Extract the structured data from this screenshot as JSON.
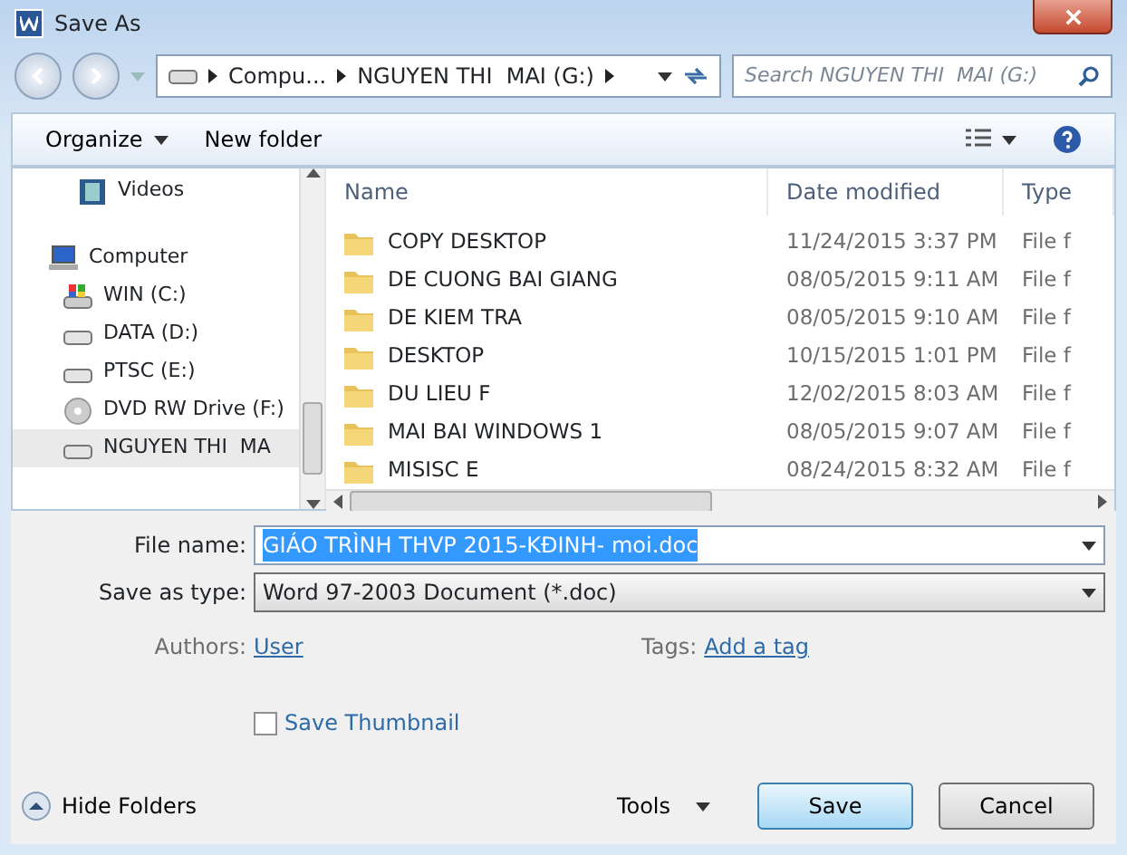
{
  "window": {
    "title": "Save As"
  },
  "address_bar": {
    "crumbs": [
      "Compu...",
      "NGUYEN THI  MAI (G:)"
    ]
  },
  "search": {
    "placeholder": "Search NGUYEN THI  MAI (G:)"
  },
  "toolbar": {
    "organize": "Organize",
    "new_folder": "New folder"
  },
  "sidebar": {
    "items": [
      {
        "label": "Videos",
        "kind": "video",
        "selected": false
      },
      {
        "label": "Computer",
        "kind": "computer",
        "selected": false
      },
      {
        "label": "WIN (C:)",
        "kind": "system-drive",
        "selected": false
      },
      {
        "label": "DATA (D:)",
        "kind": "drive",
        "selected": false
      },
      {
        "label": "PTSC (E:)",
        "kind": "drive",
        "selected": false
      },
      {
        "label": "DVD RW Drive (F:)",
        "kind": "dvd",
        "selected": false
      },
      {
        "label": "NGUYEN THI  MA",
        "kind": "drive",
        "selected": true
      }
    ]
  },
  "table": {
    "columns": [
      "Name",
      "Date modified",
      "Type"
    ],
    "rows": [
      [
        "COPY DESKTOP",
        "11/24/2015 3:37 PM",
        "File f"
      ],
      [
        "DE CUONG BAI GIANG",
        "08/05/2015 9:11 AM",
        "File f"
      ],
      [
        "DE KIEM TRA",
        "08/05/2015 9:10 AM",
        "File f"
      ],
      [
        "DESKTOP",
        "10/15/2015 1:01 PM",
        "File f"
      ],
      [
        "DU LIEU F",
        "12/02/2015 8:03 AM",
        "File f"
      ],
      [
        "MAI BAI WINDOWS 1",
        "08/05/2015 9:07 AM",
        "File f"
      ],
      [
        "MISISC E",
        "08/24/2015 8:32 AM",
        "File f"
      ]
    ]
  },
  "form": {
    "file_name_label": "File name:",
    "file_name": "GIÁO TRÌNH THVP 2015-KĐINH- moi.doc",
    "file_name_highlighted": true,
    "type_label": "Save as type:",
    "type": "Word 97-2003 Document (*.doc)",
    "authors_label": "Authors:",
    "authors": "User",
    "tags_label": "Tags:",
    "tags": "Add a tag",
    "thumbnail_label": "Save Thumbnail",
    "thumbnail_checked": false
  },
  "footer": {
    "hide_folders": "Hide Folders",
    "tools": "Tools",
    "save": "Save",
    "cancel": "Cancel"
  }
}
